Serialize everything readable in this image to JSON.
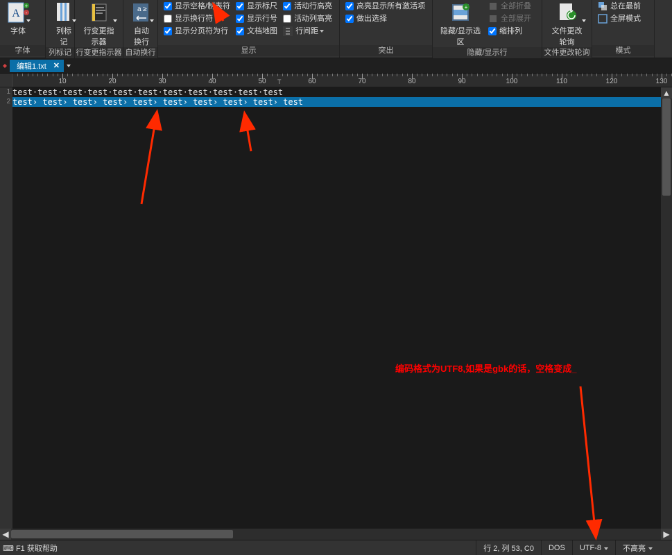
{
  "ribbon": {
    "groups": {
      "font": {
        "caption": "字体",
        "button": "字体"
      },
      "colmark": {
        "caption": "列标记",
        "button": "列标记"
      },
      "linechgind": {
        "caption": "行变更指示器",
        "button": "行变更指示器"
      },
      "autowrap": {
        "caption": "自动换行",
        "button": "自动换行"
      },
      "display": {
        "caption": "显示",
        "col1": [
          {
            "label": "显示空格/制表符",
            "checked": true
          },
          {
            "label": "显示换行符",
            "checked": false
          },
          {
            "label": "显示分页符为行",
            "checked": true
          }
        ],
        "col2": [
          {
            "label": "显示标尺",
            "checked": true
          },
          {
            "label": "显示行号",
            "checked": true
          },
          {
            "label": "文档地图",
            "checked": true
          }
        ],
        "col3": [
          {
            "label": "活动行高亮",
            "checked": true
          },
          {
            "label": "活动列高亮",
            "checked": false
          },
          {
            "label": "行间距",
            "button": true
          }
        ]
      },
      "highlight": {
        "caption": "突出",
        "items": [
          {
            "label": "高亮显示所有激活项",
            "checked": true
          },
          {
            "label": "做出选择",
            "checked": true
          }
        ]
      },
      "hideshow": {
        "caption": "隐藏/显示行",
        "hideselect_button": "隐藏/显示选区",
        "items": [
          "全部折叠",
          "全部展开",
          "缩排列"
        ]
      },
      "filepoll": {
        "caption": "文件更改轮询",
        "button": "文件更改轮询"
      },
      "mode": {
        "caption": "模式",
        "items": [
          "总在最前",
          "全屏模式"
        ]
      }
    }
  },
  "tab": {
    "name": "编辑1.txt",
    "close": "✕"
  },
  "ruler_markerT": "T",
  "editor": {
    "line1": "test·test·test·test·test·test·test·test·test·test·test",
    "line2": "test› test› test› test› test› test› test› test› test› test",
    "lineno1": "1",
    "lineno2": "2"
  },
  "annotation": "编码格式为UTF8,如果是gbk的话，空格变成_",
  "status": {
    "help": "F1 获取帮助",
    "pos": "行 2, 列 53, C0",
    "eol": "DOS",
    "encoding": "UTF-8",
    "syntax": "不高亮"
  }
}
